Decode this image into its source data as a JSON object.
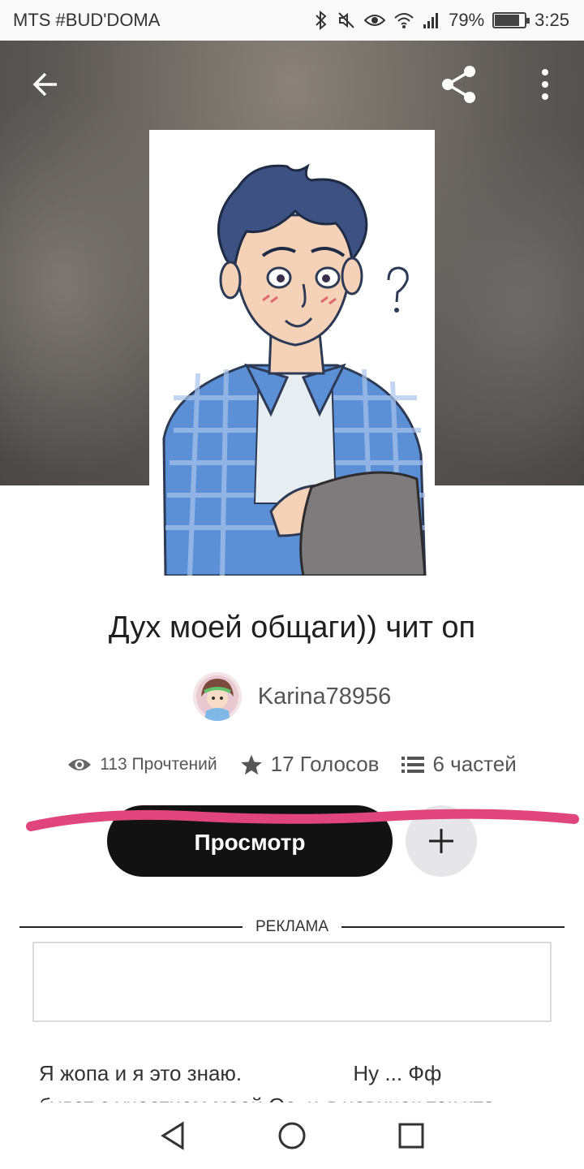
{
  "status_bar": {
    "carrier": "MTS #BUD'DOMA",
    "battery_percent": "79%",
    "battery_level": 0.79,
    "time": "3:25",
    "icons": [
      "bluetooth-icon",
      "mute-icon",
      "eye-icon",
      "wifi-icon",
      "signal-icon",
      "battery-icon"
    ]
  },
  "header": {
    "back_icon": "arrow-left-icon",
    "share_icon": "share-icon",
    "more_icon": "more-vertical-icon"
  },
  "story": {
    "title": "Дух моей общаги)) чит оп",
    "author": "Karina78956",
    "stats": {
      "reads": "113 Прочтений",
      "votes": "17 Голосов",
      "parts": "6 частей"
    }
  },
  "actions": {
    "view_label": "Просмотр",
    "add_icon": "plus-icon"
  },
  "ad": {
    "label": "РЕКЛАМА"
  },
  "description": {
    "text": "Я жопа и я это знаю.                   Ну ... Фф\nбудет с участием моей Ос. и я новичок так что"
  },
  "colors": {
    "primary_button": "#121212",
    "annotation_stroke": "#e0457b",
    "secondary_button": "#e6e6e8"
  }
}
